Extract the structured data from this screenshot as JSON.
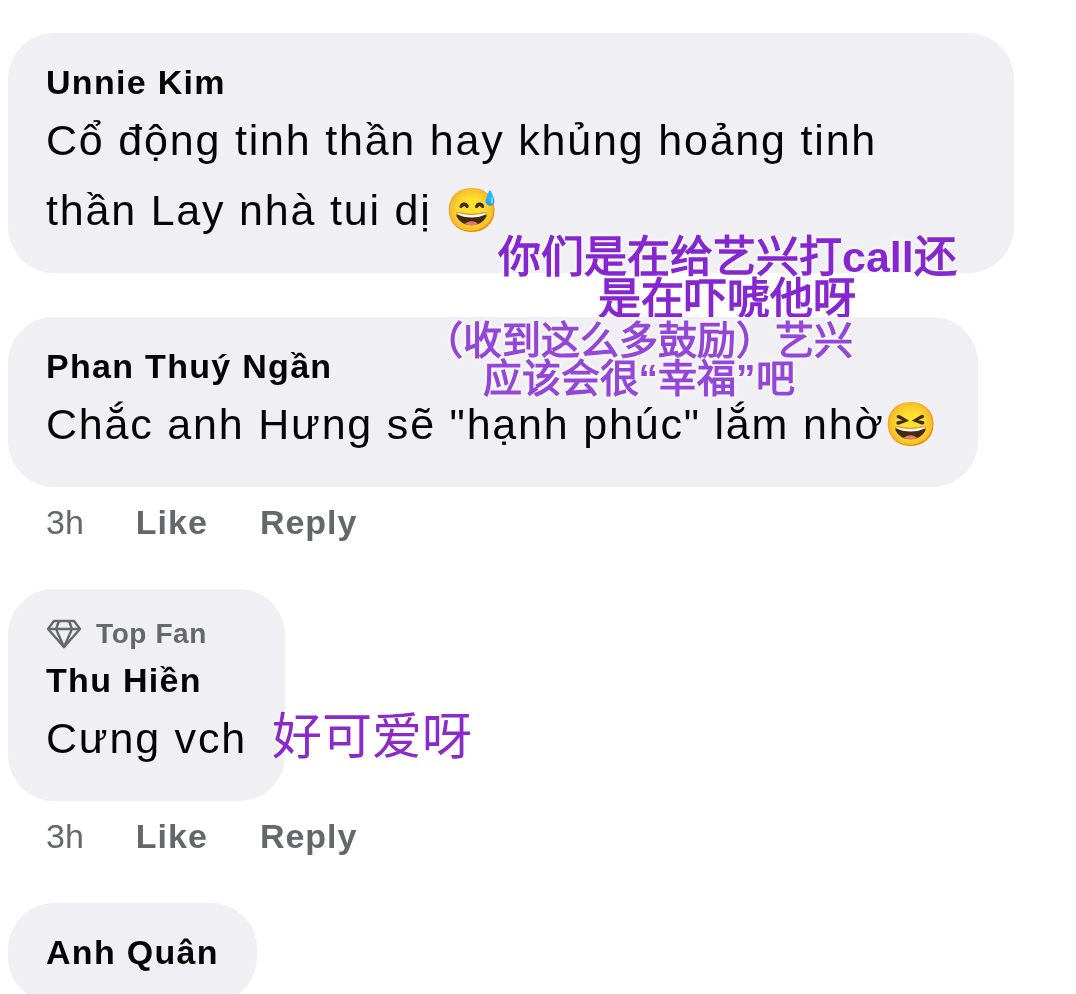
{
  "comments": [
    {
      "author": "Unnie Kim",
      "text": "Cổ động tinh thần hay khủng hoảng tinh thần Lay nhà tui dị 😅",
      "note": {
        "lines": [
          "你们是在给艺兴打call还",
          "是在吓唬他呀"
        ]
      }
    },
    {
      "author": "Phan Thuý Ngần",
      "text": "Chắc anh Hưng sẽ \"hạnh phúc\" lắm nhờ😆",
      "note": {
        "lines": [
          "（收到这么多鼓励）艺兴",
          "应该会很“幸福”吧"
        ]
      },
      "actions": {
        "time": "3h",
        "like": "Like",
        "reply": "Reply"
      }
    },
    {
      "badge": "Top Fan",
      "author": "Thu Hiền",
      "text": "Cưng vch",
      "note": {
        "lines": [
          "好可爱呀"
        ]
      },
      "actions": {
        "time": "3h",
        "like": "Like",
        "reply": "Reply"
      }
    },
    {
      "author": "Anh Quân"
    }
  ]
}
